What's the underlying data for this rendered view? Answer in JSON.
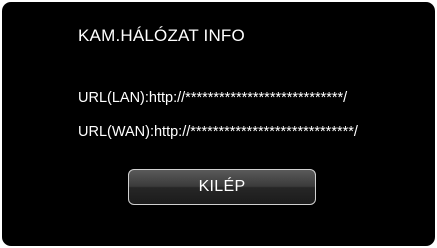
{
  "screen": {
    "title": "KAM.HÁLÓZAT INFO",
    "url_lan": "URL(LAN):http://****************************/",
    "url_wan": "URL(WAN):http://*****************************/",
    "exit_button_label": "KILÉP"
  },
  "colors": {
    "background": "#000000",
    "text": "#ffffff",
    "button_border": "#d0d0d0"
  }
}
